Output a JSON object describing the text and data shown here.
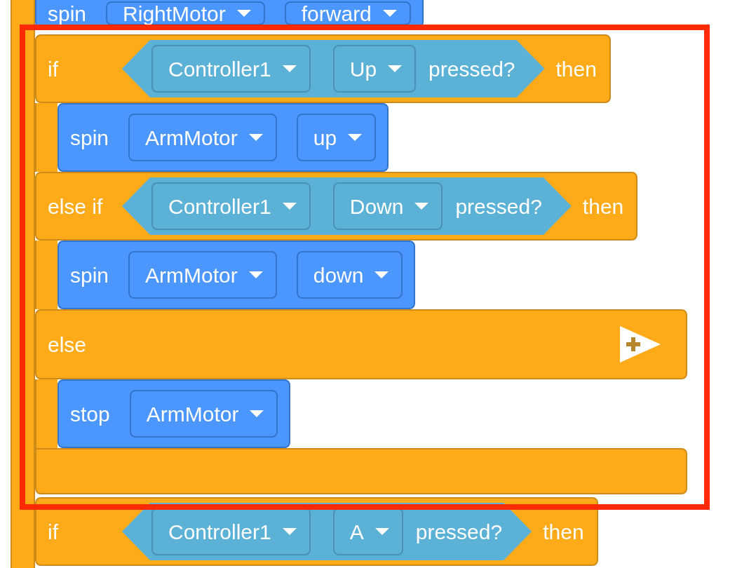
{
  "top_block": {
    "kind": "command",
    "label": "spin",
    "fields": [
      "RightMotor",
      "forward"
    ]
  },
  "highlighted_rows": [
    {
      "kind": "header",
      "label": "if",
      "fields": [
        "Controller1",
        "Up"
      ],
      "condition_label": "pressed?",
      "then": "then"
    },
    {
      "kind": "command",
      "label": "spin",
      "fields": [
        "ArmMotor",
        "up"
      ]
    },
    {
      "kind": "header",
      "label": "else if",
      "fields": [
        "Controller1",
        "Down"
      ],
      "condition_label": "pressed?",
      "then": "then"
    },
    {
      "kind": "command",
      "label": "spin",
      "fields": [
        "ArmMotor",
        "down"
      ]
    },
    {
      "kind": "else",
      "label": "else"
    },
    {
      "kind": "command",
      "label": "stop",
      "fields": [
        "ArmMotor"
      ]
    },
    {
      "kind": "end"
    }
  ],
  "below_rows": [
    {
      "kind": "header",
      "label": "if",
      "fields": [
        "Controller1",
        "A"
      ],
      "condition_label": "pressed?",
      "then": "then"
    }
  ]
}
